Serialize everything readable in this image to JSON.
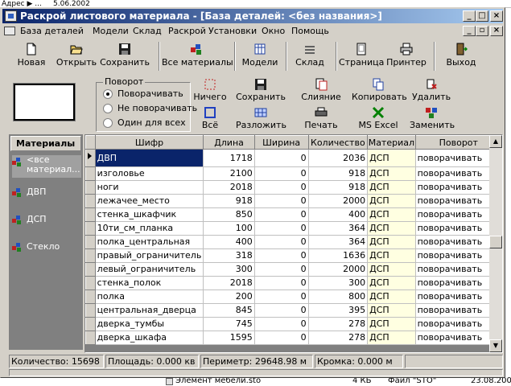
{
  "background": {
    "top_text": "Адрес  ▶ ...",
    "top_file": "5.06.2002",
    "bottom_file": "Элемент мебели.sto",
    "bottom_size": "4 КБ",
    "bottom_type": "Файл \"STO\"",
    "bottom_date": "23.08.200"
  },
  "window": {
    "title": "Раскрой листового материала - [База деталей: <без названия>]"
  },
  "menu": [
    "База деталей",
    "Модели",
    "Склад",
    "Раскрой",
    "Установки",
    "Окно",
    "Помощь"
  ],
  "toolbar": [
    {
      "label": "Новая",
      "icon": "new-doc-icon"
    },
    {
      "label": "Открыть",
      "icon": "open-folder-icon"
    },
    {
      "label": "Сохранить",
      "icon": "floppy-disk-icon"
    },
    {
      "label": "Все материалы",
      "icon": "materials-icon"
    },
    {
      "label": "Модели",
      "icon": "models-icon"
    },
    {
      "label": "Склад",
      "icon": "warehouse-icon"
    },
    {
      "label": "Страница",
      "icon": "page-icon"
    },
    {
      "label": "Принтер",
      "icon": "printer-icon"
    },
    {
      "label": "Выход",
      "icon": "exit-door-icon"
    }
  ],
  "rotation": {
    "legend": "Поворот",
    "options": [
      "Поворачивать",
      "Не поворачивать",
      "Один для всех"
    ],
    "selected": 0
  },
  "actions": {
    "nothing": "Ничего",
    "all": "Всё",
    "save": "Сохранить",
    "layout": "Разложить",
    "merge": "Слияние",
    "print": "Печать",
    "copy": "Копировать",
    "excel": "MS Excel",
    "delete": "Удалить",
    "replace": "Заменить"
  },
  "sidebar": {
    "header": "Материалы",
    "items": [
      {
        "label": "<все материал...",
        "icon": "materials-icon",
        "selected": true
      },
      {
        "label": "ДВП",
        "icon": "materials-icon",
        "selected": false
      },
      {
        "label": "ДСП",
        "icon": "materials-icon",
        "selected": false
      },
      {
        "label": "Стекло",
        "icon": "materials-icon",
        "selected": false
      }
    ]
  },
  "table": {
    "columns": [
      "Шифр",
      "Длина",
      "Ширина",
      "Количество",
      "Материал",
      "Поворот"
    ],
    "rows": [
      [
        "ДВП",
        "1718",
        "0",
        "2036",
        "ДСП",
        "поворачивать"
      ],
      [
        "изголовье",
        "2100",
        "0",
        "918",
        "ДСП",
        "поворачивать"
      ],
      [
        "ноги",
        "2018",
        "0",
        "918",
        "ДСП",
        "поворачивать"
      ],
      [
        "лежачее_место",
        "918",
        "0",
        "2000",
        "ДСП",
        "поворачивать"
      ],
      [
        "стенка_шкафчик",
        "850",
        "0",
        "400",
        "ДСП",
        "поворачивать"
      ],
      [
        "10ти_см_планка",
        "100",
        "0",
        "364",
        "ДСП",
        "поворачивать"
      ],
      [
        "полка_центральная",
        "400",
        "0",
        "364",
        "ДСП",
        "поворачивать"
      ],
      [
        "правый_ограничитель",
        "318",
        "0",
        "1636",
        "ДСП",
        "поворачивать"
      ],
      [
        "левый_ограничитель",
        "300",
        "0",
        "2000",
        "ДСП",
        "поворачивать"
      ],
      [
        "стенка_полок",
        "2018",
        "0",
        "300",
        "ДСП",
        "поворачивать"
      ],
      [
        "полка",
        "200",
        "0",
        "800",
        "ДСП",
        "поворачивать"
      ],
      [
        "центральная_дверца",
        "845",
        "0",
        "395",
        "ДСП",
        "поворачивать"
      ],
      [
        "дверка_тумбы",
        "745",
        "0",
        "278",
        "ДСП",
        "поворачивать"
      ],
      [
        "дверка_шкафа",
        "1595",
        "0",
        "278",
        "ДСП",
        "поворачивать"
      ]
    ],
    "selected_row": 0
  },
  "status": {
    "count": "Количество: 15698 шт",
    "area": "Площадь: 0.000 кв м",
    "perimeter": "Периметр: 29648.98 м",
    "edge": "Кромка: 0.000 м"
  }
}
